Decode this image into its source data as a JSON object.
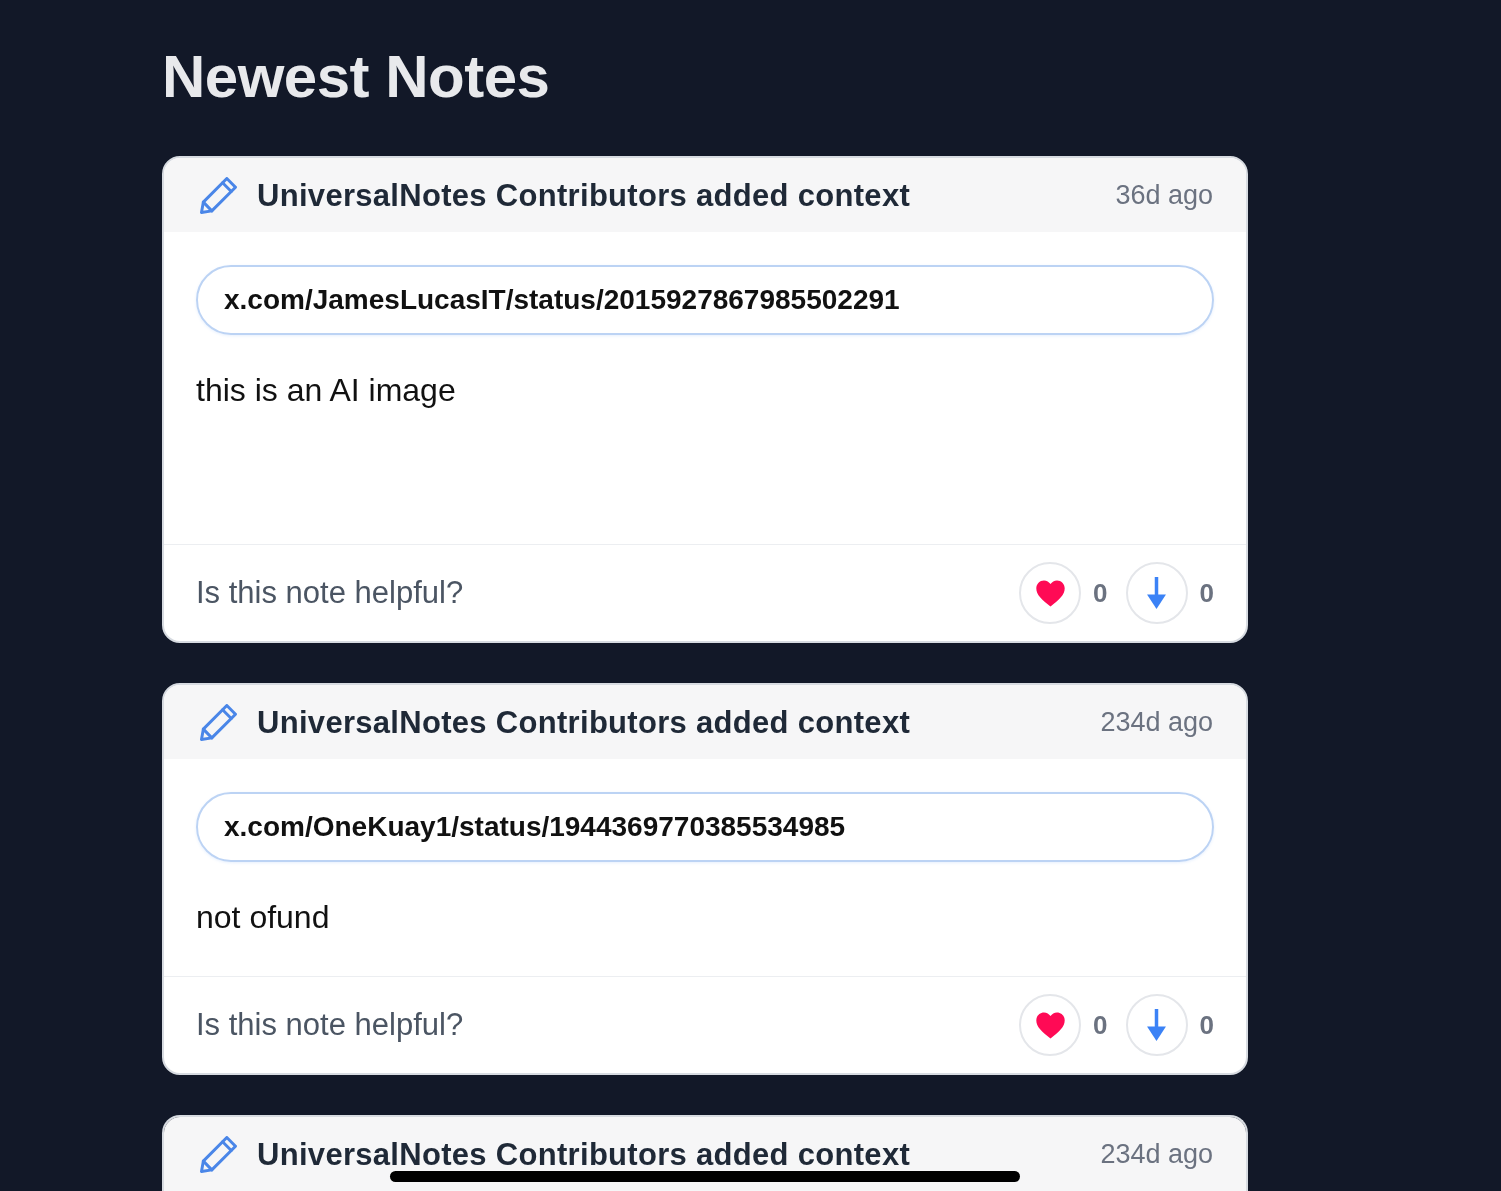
{
  "title": "Newest Notes",
  "notes": [
    {
      "header": "UniversalNotes Contributors added context",
      "time": "36d ago",
      "url": "x.com/JamesLucasIT/status/2015927867985502291",
      "text": "this is an AI image",
      "prompt": "Is this note helpful?",
      "likes": "0",
      "dislikes": "0"
    },
    {
      "header": "UniversalNotes Contributors added context",
      "time": "234d ago",
      "url": "x.com/OneKuay1/status/1944369770385534985",
      "text": "not ofund",
      "prompt": "Is this note helpful?",
      "likes": "0",
      "dislikes": "0"
    },
    {
      "header": "UniversalNotes Contributors added context",
      "time": "234d ago"
    }
  ]
}
